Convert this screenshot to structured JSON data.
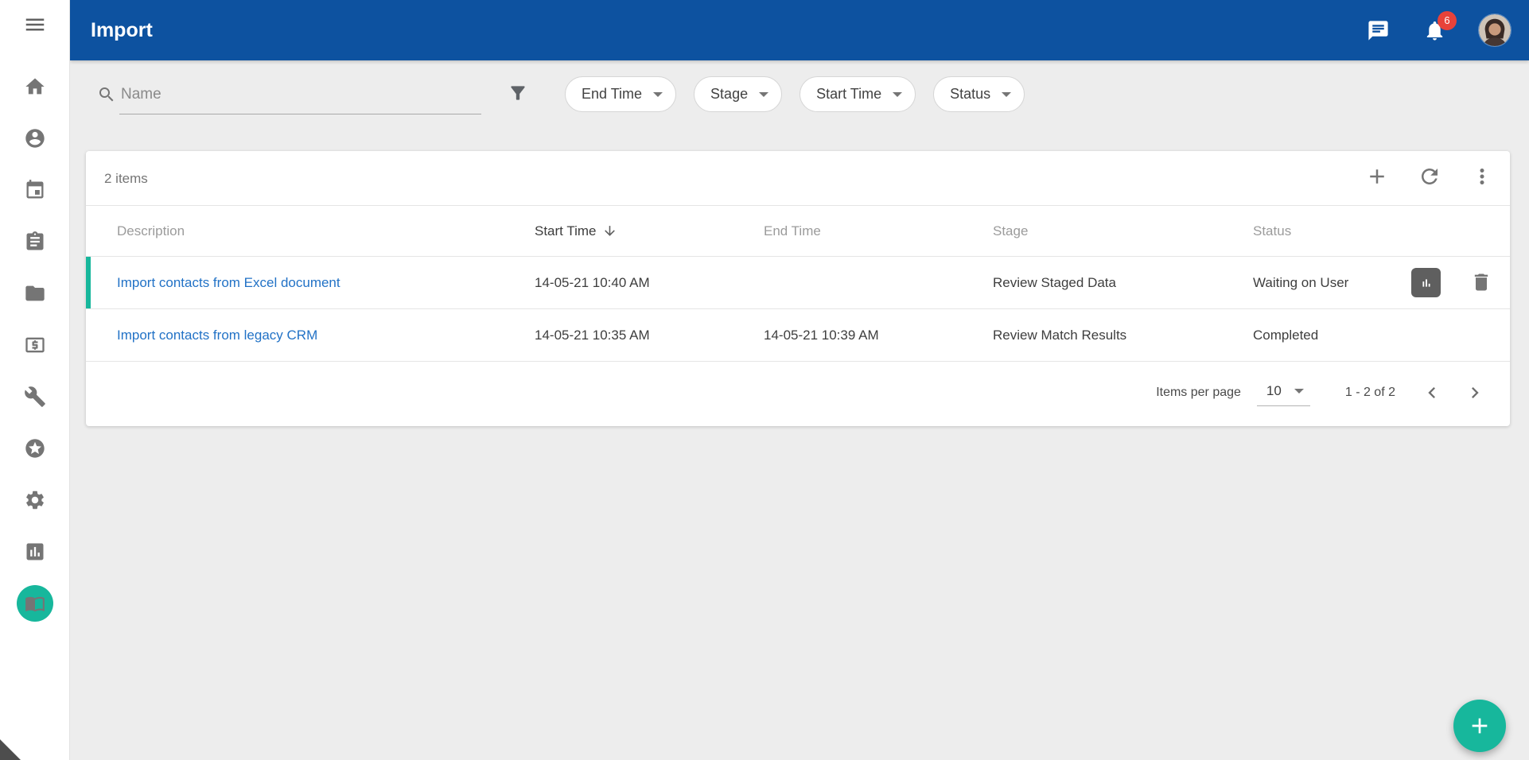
{
  "colors": {
    "header_bg": "#0d52a0",
    "accent": "#17b79c",
    "link": "#2272c6",
    "badge": "#e8423a",
    "icon_gray": "#757575"
  },
  "header": {
    "title": "Import",
    "notification_count": "6",
    "icons": [
      "chat-icon",
      "notifications-bell-icon",
      "avatar"
    ]
  },
  "sidebar": {
    "icons": [
      "menu-icon",
      "home-icon",
      "account-icon",
      "calendar-icon",
      "tasks-icon",
      "folder-icon",
      "billing-icon",
      "wrench-icon",
      "featured-star-icon",
      "settings-gear-icon",
      "reports-chart-icon",
      "book-icon"
    ],
    "active_icon": "book-icon"
  },
  "filters": {
    "search_placeholder": "Name",
    "filter_icon": "funnel-icon",
    "chips": [
      {
        "label": "End Time"
      },
      {
        "label": "Stage"
      },
      {
        "label": "Start Time"
      },
      {
        "label": "Status"
      }
    ]
  },
  "table": {
    "summary": "2 items",
    "toolbar_icons": [
      "add-icon",
      "refresh-icon",
      "kebab-menu-icon"
    ],
    "columns": [
      {
        "label": "Description"
      },
      {
        "label": "Start Time"
      },
      {
        "label": "End Time"
      },
      {
        "label": "Stage"
      },
      {
        "label": "Status"
      }
    ],
    "sort": {
      "column": "Start Time",
      "direction": "desc"
    },
    "rows": [
      {
        "description": "Import contacts from Excel document",
        "start_time": "14-05-21 10:40 AM",
        "end_time": "",
        "stage": "Review Staged Data",
        "status": "Waiting on User",
        "selected": true,
        "actions": [
          "chart-icon",
          "trash-icon"
        ]
      },
      {
        "description": "Import contacts from legacy CRM",
        "start_time": "14-05-21 10:35 AM",
        "end_time": "14-05-21 10:39 AM",
        "stage": "Review Match Results",
        "status": "Completed",
        "selected": false,
        "actions": []
      }
    ],
    "pagination": {
      "items_per_page_label": "Items per page",
      "page_size": "10",
      "range": "1 - 2 of 2"
    }
  },
  "fab": {
    "icon": "add-icon"
  }
}
